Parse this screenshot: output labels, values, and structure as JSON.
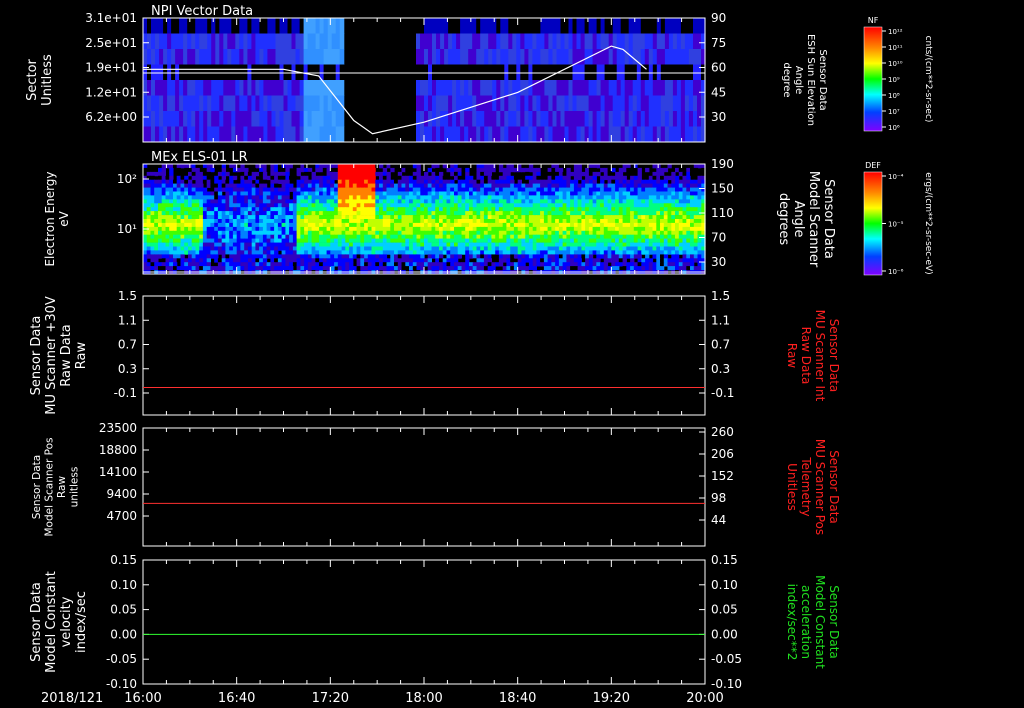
{
  "chart_data": [
    {
      "type": "heatmap",
      "title": "NPI Vector Data",
      "ylabel": "Sector\nUnitless",
      "yticks": [
        "3.1e+01",
        "2.5e+01",
        "1.9e+01",
        "1.2e+01",
        "6.2e+00"
      ],
      "y2label": "Sensor Data\nESH Sun Elevation\nAngle\ndegree",
      "y2ticks": [
        "90",
        "75",
        "60",
        "45",
        "30"
      ],
      "overlay_series": [
        {
          "x": [
            "16:00",
            "17:00",
            "17:15",
            "17:30",
            "17:38",
            "18:00",
            "18:40",
            "19:20",
            "19:25",
            "19:35"
          ],
          "y": [
            59,
            59,
            55,
            28,
            20,
            27,
            45,
            73,
            71,
            59
          ]
        }
      ],
      "colorbar": {
        "label": "NF",
        "units": "cnts/(cm**2-sr-sec)",
        "ticks": [
          "10¹²",
          "10¹¹",
          "10¹⁰",
          "10⁹",
          "10⁸",
          "10⁷",
          "10⁶"
        ]
      }
    },
    {
      "type": "heatmap",
      "title": "MEx ELS-01 LR",
      "ylabel": "Electron Energy\neV",
      "yticks": [
        "10²",
        "10¹"
      ],
      "y2label": "Sensor Data\nModel Scanner\nAngle\ndegrees",
      "y2ticks": [
        "190",
        "150",
        "110",
        "70",
        "30"
      ],
      "colorbar": {
        "label": "DEF",
        "units": "ergs/(cm**2-sr-sec-eV)",
        "ticks": [
          "10⁻⁴",
          "10⁻⁵",
          "10⁻⁶"
        ]
      }
    },
    {
      "type": "line",
      "ylabel": "Sensor Data\nMU Scanner +30V\nRaw Data\nRaw",
      "yticks": [
        "1.5",
        "1.1",
        "0.7",
        "0.3",
        "-0.1"
      ],
      "y2label": "Sensor Data\nMU Scanner Int\nRaw Data\nRaw",
      "y2ticks": [
        "1.5",
        "1.1",
        "0.7",
        "0.3",
        "-0.1"
      ],
      "ylim": [
        -0.4,
        1.5
      ],
      "series": [
        {
          "x": [
            "16:00",
            "20:00"
          ],
          "y": [
            0.04,
            0.04
          ],
          "color": "#ff3030"
        }
      ]
    },
    {
      "type": "line",
      "ylabel": "Sensor Data\nModel Scanner Pos\nRaw\nunitless",
      "yticks": [
        "23500",
        "18800",
        "14100",
        "9400",
        "4700"
      ],
      "y2label": "Sensor Data\nMU Scanner Pos\nTelemetry\nUnitless",
      "y2ticks": [
        "260",
        "206",
        "152",
        "98",
        "44"
      ],
      "ylim": [
        0,
        23500
      ],
      "series": [
        {
          "x": [
            "16:00",
            "20:00"
          ],
          "y": [
            8500,
            8500
          ],
          "color": "#ff3030"
        }
      ]
    },
    {
      "type": "line",
      "ylabel": "Sensor Data\nModel Constant\nvelocity\nindex/sec",
      "yticks": [
        "0.15",
        "0.10",
        "0.05",
        "0.00",
        "-0.05",
        "-0.10"
      ],
      "y2label": "Sensor Data\nModel Constant\nacceleration\nindex/sec**2",
      "y2ticks": [
        "0.15",
        "0.10",
        "0.05",
        "0.00",
        "-0.05",
        "-0.10"
      ],
      "ylim": [
        -0.1,
        0.15
      ],
      "series": [
        {
          "x": [
            "16:00",
            "20:00"
          ],
          "y": [
            0.0,
            0.0
          ],
          "color": "#30ff30"
        }
      ]
    }
  ],
  "xaxis": {
    "date": "2018/121",
    "ticks": [
      "16:00",
      "16:40",
      "17:20",
      "18:00",
      "18:40",
      "19:20",
      "20:00"
    ],
    "range": [
      "16:00",
      "20:00"
    ]
  },
  "colors": {
    "red_label": "#ff2020",
    "green_label": "#20e020",
    "axis": "#ffffff"
  }
}
